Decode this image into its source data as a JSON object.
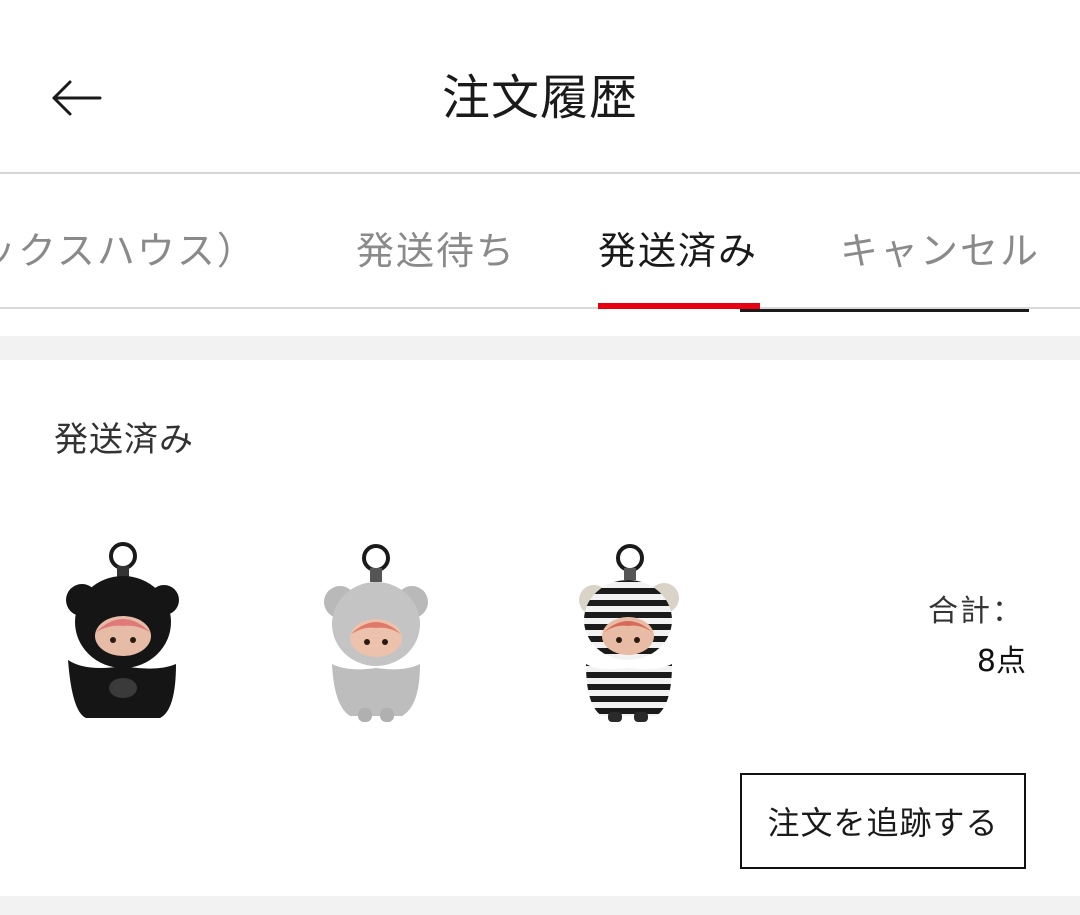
{
  "header": {
    "title": "注文履歴",
    "back_icon": "arrow-left-icon"
  },
  "tabs": [
    {
      "label": "ックスハウス）",
      "active": false
    },
    {
      "label": "発送待ち",
      "active": false
    },
    {
      "label": "発送済み",
      "active": true
    },
    {
      "label": "キャンセル",
      "active": false
    }
  ],
  "colors": {
    "accent": "#e60012",
    "text_primary": "#1a1a1a",
    "text_muted": "#8a8a8a",
    "separator": "#f2f2f2"
  },
  "order": {
    "status": "発送済み",
    "products": [
      {
        "name": "black-plush-bear-doll-keychain",
        "color": "#151515"
      },
      {
        "name": "gray-plush-bear-doll-keychain",
        "color": "#b9b9b9"
      },
      {
        "name": "striped-bear-doll-keychain",
        "color": "#202020"
      }
    ],
    "total_label": "合計：",
    "total_count": "8点",
    "track_button_label": "注文を追跡する"
  }
}
